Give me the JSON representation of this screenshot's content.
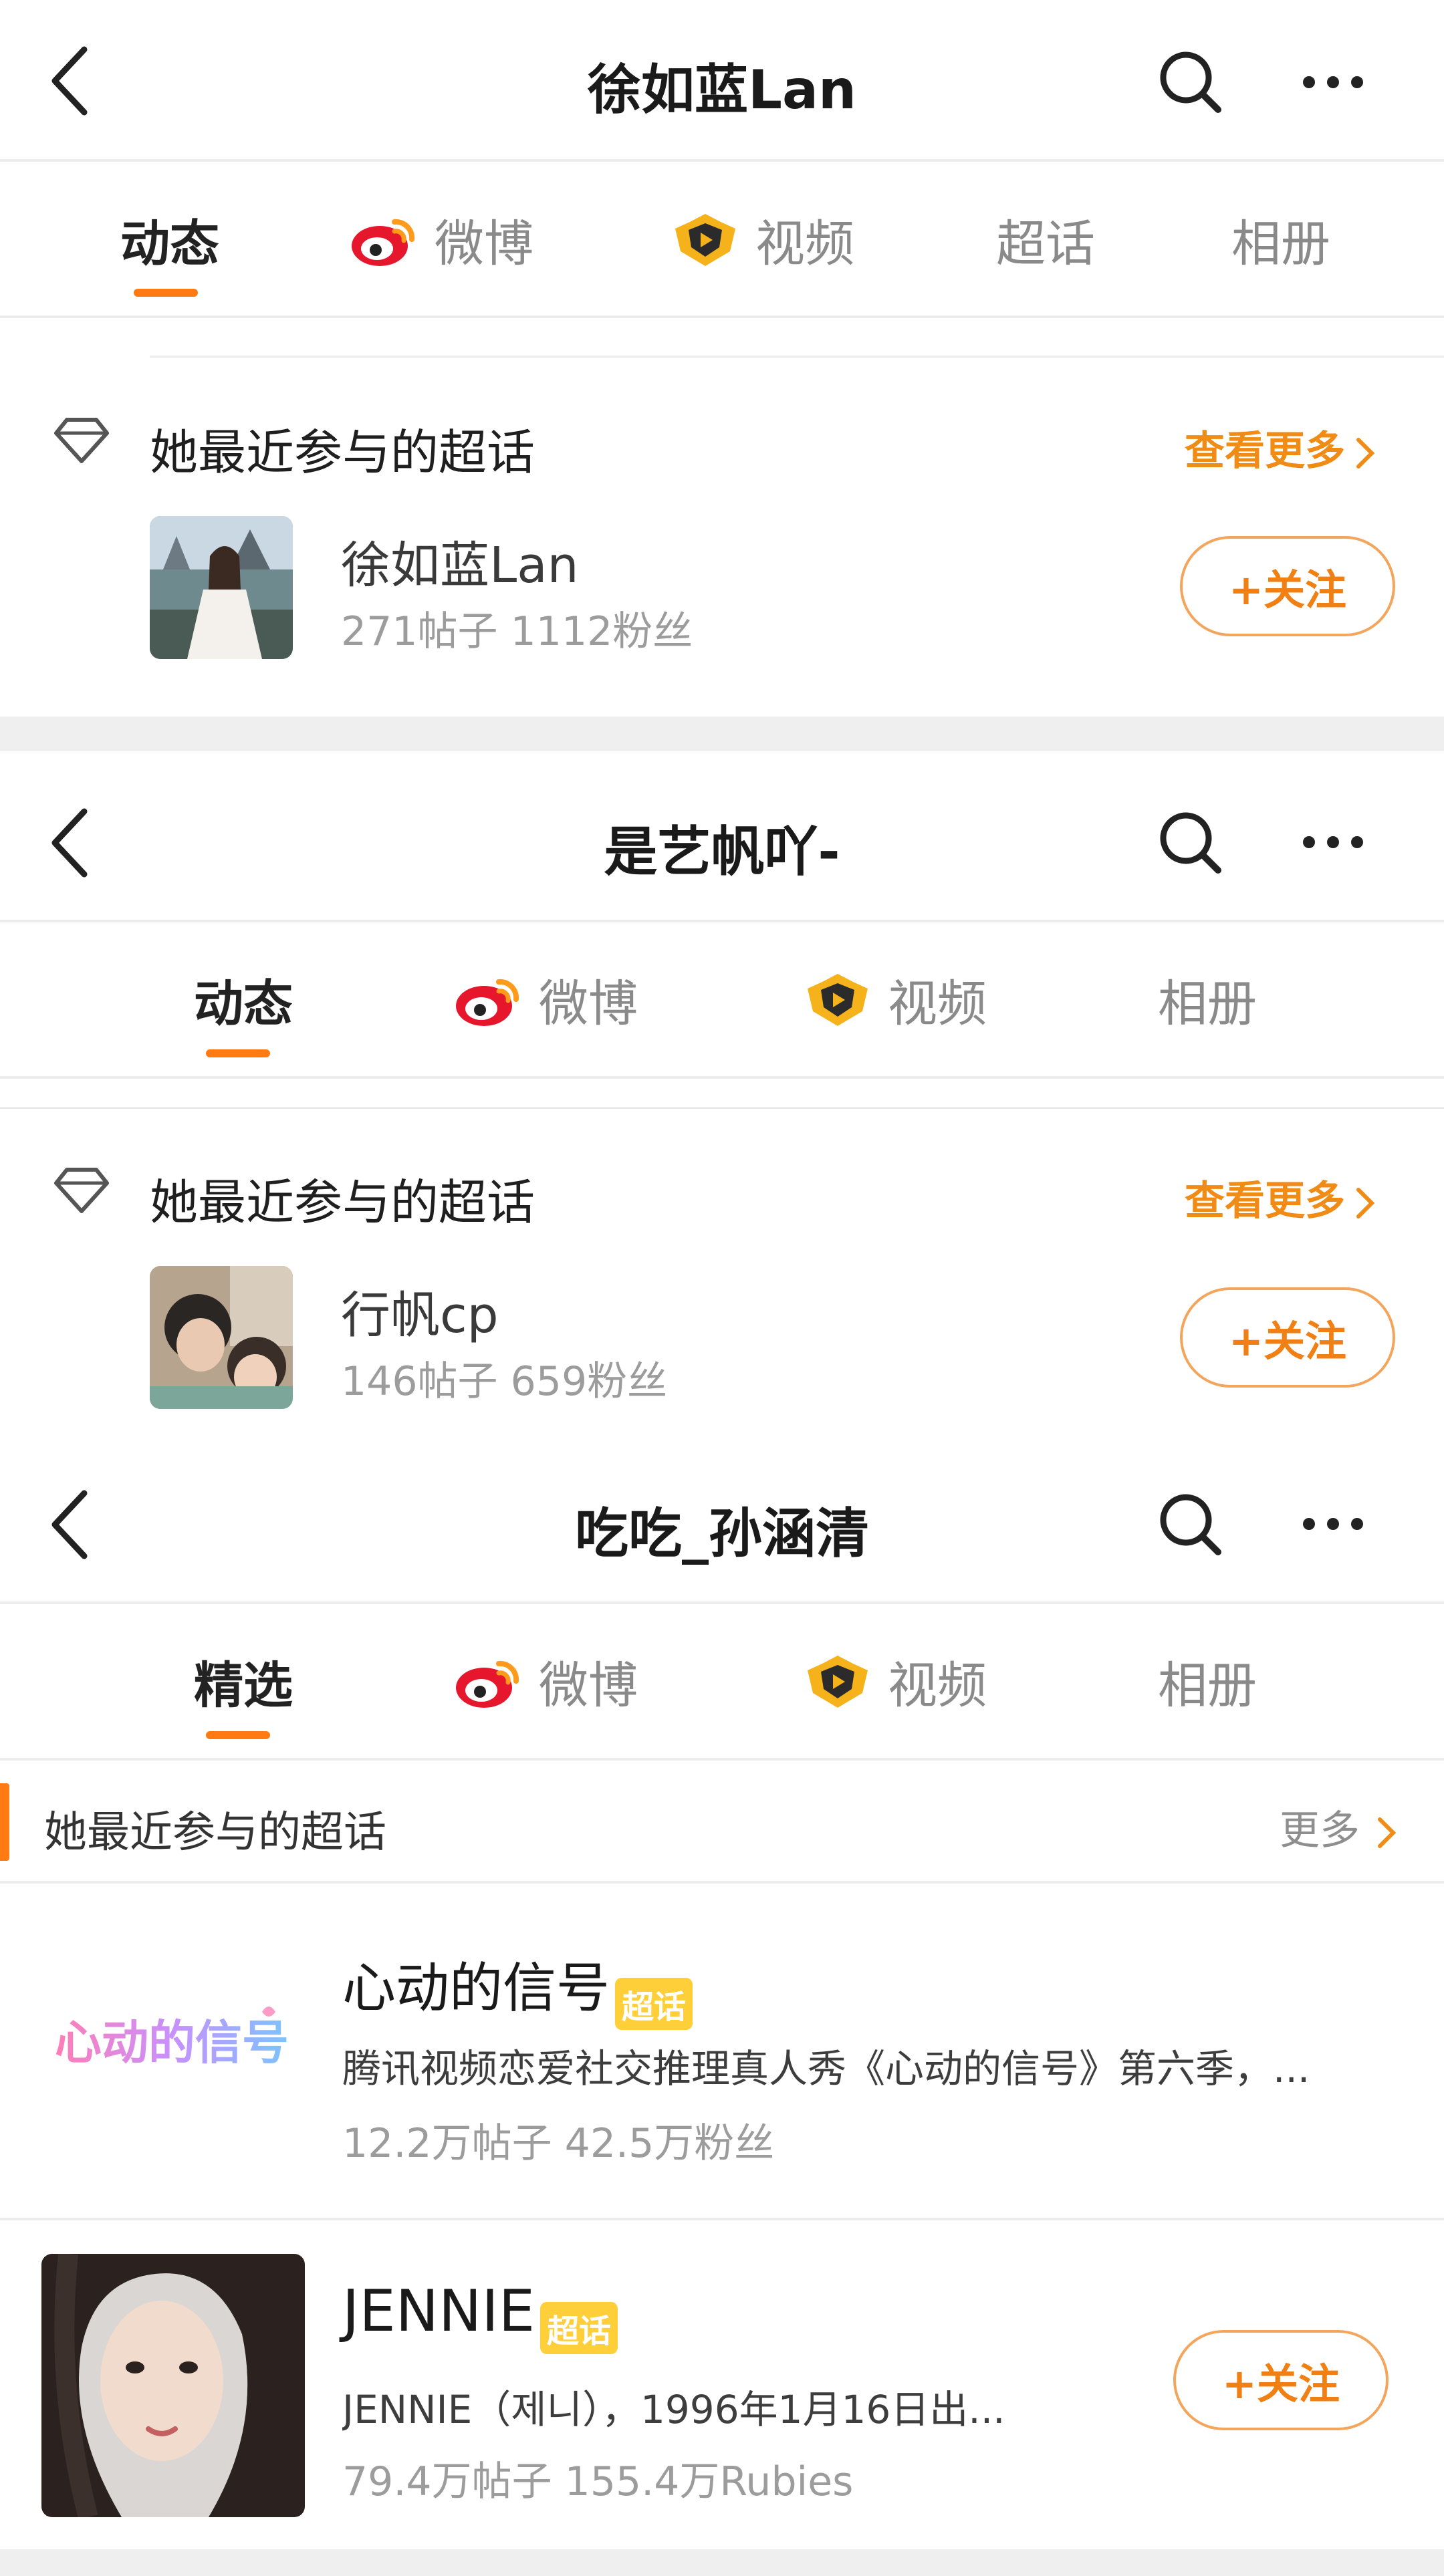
{
  "colors": {
    "accent": "#ff7a12",
    "link": "#f08c16",
    "follow_border": "#f2a55b",
    "tag_bg": "#ffcf3a"
  },
  "profile1": {
    "title": "徐如蓝Lan",
    "tabs": [
      {
        "label": "动态"
      },
      {
        "label": "微博"
      },
      {
        "label": "视频"
      },
      {
        "label": "超话"
      },
      {
        "label": "相册"
      }
    ],
    "section_title": "她最近参与的超话",
    "more": "查看更多",
    "item": {
      "name": "徐如蓝Lan",
      "stats": "271帖子 1112粉丝",
      "follow": "+关注"
    }
  },
  "profile2": {
    "title": "是艺帆吖-",
    "tabs": [
      {
        "label": "动态"
      },
      {
        "label": "微博"
      },
      {
        "label": "视频"
      },
      {
        "label": "相册"
      }
    ],
    "section_title": "她最近参与的超话",
    "more": "查看更多",
    "item": {
      "name": "行帆cp",
      "stats": "146帖子 659粉丝",
      "follow": "+关注"
    }
  },
  "profile3": {
    "title": "吃吃_孙涵清",
    "tabs": [
      {
        "label": "精选"
      },
      {
        "label": "微博"
      },
      {
        "label": "视频"
      },
      {
        "label": "相册"
      }
    ],
    "section_title": "她最近参与的超话",
    "more": "更多",
    "items": [
      {
        "name": "心动的信号",
        "tag": "超话",
        "desc": "腾讯视频恋爱社交推理真人秀《心动的信号》第六季，...",
        "stats": "12.2万帖子 42.5万粉丝",
        "logo_text": "心动的信号"
      },
      {
        "name": "JENNIE",
        "tag": "超话",
        "desc": "JENNIE（제니），1996年1月16日出...",
        "stats": "79.4万帖子 155.4万Rubies",
        "follow": "+关注"
      }
    ]
  }
}
